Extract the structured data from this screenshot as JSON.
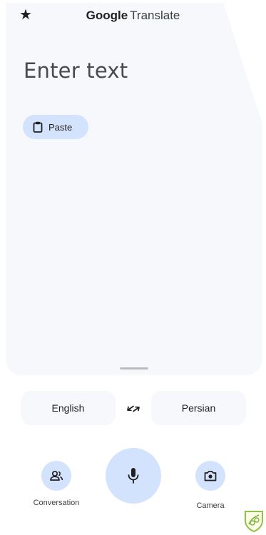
{
  "header": {
    "favorite_icon": "star-icon",
    "brand_google": "Google",
    "brand_translate": "Translate"
  },
  "input": {
    "placeholder": "Enter text",
    "paste_label": "Paste",
    "paste_icon": "clipboard-icon"
  },
  "languages": {
    "source": "English",
    "target": "Persian",
    "swap_icon": "swap-arrows-icon"
  },
  "actions": {
    "conversation_label": "Conversation",
    "conversation_icon": "people-icon",
    "mic_icon": "microphone-icon",
    "camera_label": "Camera",
    "camera_icon": "camera-icon"
  },
  "colors": {
    "accent_light": "#d3e3fd",
    "card_bg": "#f6f8fc",
    "badge": "#8bc34a"
  },
  "badge_icon": "shield-badge-icon"
}
